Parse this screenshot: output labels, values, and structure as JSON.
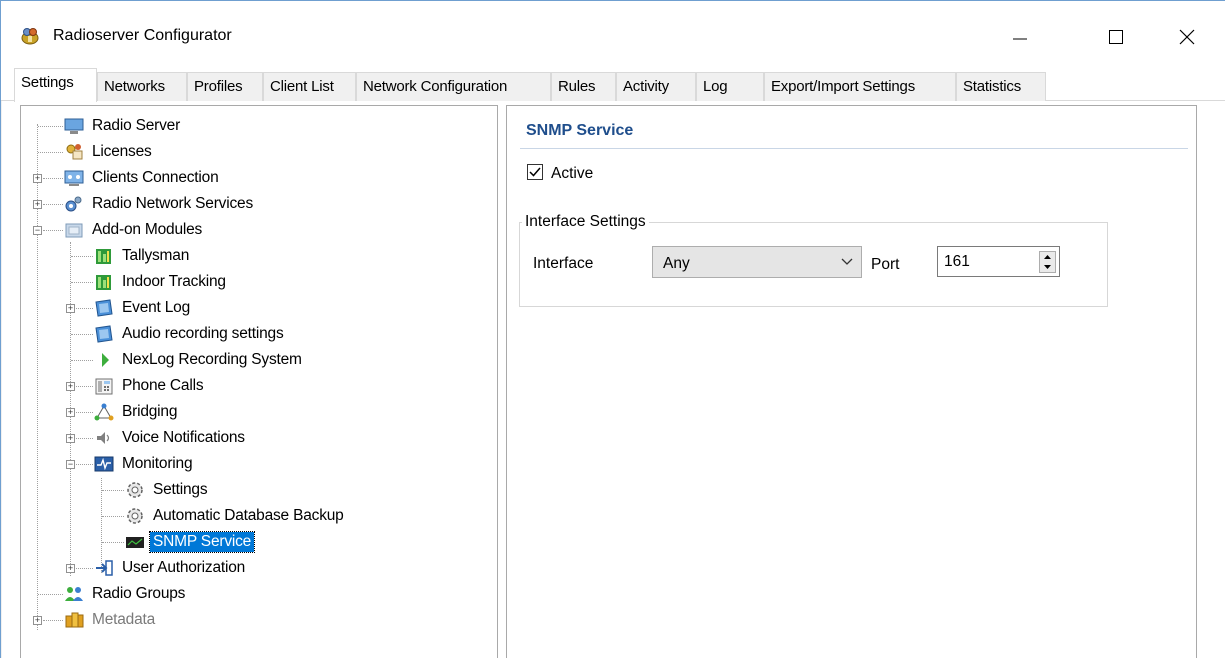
{
  "window": {
    "title": "Radioserver Configurator",
    "icon": "radioserver-app-icon",
    "controls": [
      "minimize-icon",
      "maximize-icon",
      "close-icon"
    ]
  },
  "tabs": [
    {
      "label": "Settings",
      "active": true
    },
    {
      "label": "Networks"
    },
    {
      "label": "Profiles"
    },
    {
      "label": "Client List"
    },
    {
      "label": "Network Configuration"
    },
    {
      "label": "Rules"
    },
    {
      "label": "Activity"
    },
    {
      "label": "Log"
    },
    {
      "label": "Export/Import Settings"
    },
    {
      "label": "Statistics"
    }
  ],
  "tree": {
    "items": [
      {
        "label": "Radio Server",
        "icon": "server-icon",
        "level": 0,
        "expander": "none"
      },
      {
        "label": "Licenses",
        "icon": "licenses-icon",
        "level": 0,
        "expander": "none"
      },
      {
        "label": "Clients Connection",
        "icon": "clients-connection-icon",
        "level": 0,
        "expander": "plus"
      },
      {
        "label": "Radio Network Services",
        "icon": "network-services-icon",
        "level": 0,
        "expander": "plus"
      },
      {
        "label": "Add-on Modules",
        "icon": "addon-modules-icon",
        "level": 0,
        "expander": "minus"
      },
      {
        "label": "Tallysman",
        "icon": "tallysman-icon",
        "level": 1,
        "expander": "none"
      },
      {
        "label": "Indoor Tracking",
        "icon": "indoor-tracking-icon",
        "level": 1,
        "expander": "none"
      },
      {
        "label": "Event Log",
        "icon": "event-log-icon",
        "level": 1,
        "expander": "plus"
      },
      {
        "label": "Audio recording settings",
        "icon": "audio-recording-icon",
        "level": 1,
        "expander": "none"
      },
      {
        "label": "NexLog Recording System",
        "icon": "nexlog-icon",
        "level": 1,
        "expander": "none"
      },
      {
        "label": "Phone Calls",
        "icon": "phone-calls-icon",
        "level": 1,
        "expander": "plus"
      },
      {
        "label": "Bridging",
        "icon": "bridging-icon",
        "level": 1,
        "expander": "plus"
      },
      {
        "label": "Voice Notifications",
        "icon": "speaker-icon",
        "level": 1,
        "expander": "plus"
      },
      {
        "label": "Monitoring",
        "icon": "monitoring-icon",
        "level": 1,
        "expander": "minus"
      },
      {
        "label": "Settings",
        "icon": "gear-icon",
        "level": 2,
        "expander": "none"
      },
      {
        "label": "Automatic Database Backup",
        "icon": "gear-icon",
        "level": 2,
        "expander": "none"
      },
      {
        "label": "SNMP Service",
        "icon": "snmp-icon",
        "level": 2,
        "expander": "none",
        "selected": true
      },
      {
        "label": "User Authorization",
        "icon": "user-authorization-icon",
        "level": 1,
        "expander": "plus"
      },
      {
        "label": "Radio Groups",
        "icon": "radio-groups-icon",
        "level": 0,
        "expander": "none"
      },
      {
        "label": "Metadata",
        "icon": "metadata-icon",
        "level": 0,
        "expander": "plus",
        "disabled": true
      }
    ]
  },
  "panel": {
    "title": "SNMP Service",
    "active_label": "Active",
    "active_checked": true,
    "group_title": "Interface Settings",
    "interface_label": "Interface",
    "interface_value": "Any",
    "port_label": "Port",
    "port_value": "161"
  },
  "colors": {
    "selection": "#0078d7",
    "section_title": "#1f4e8c"
  }
}
